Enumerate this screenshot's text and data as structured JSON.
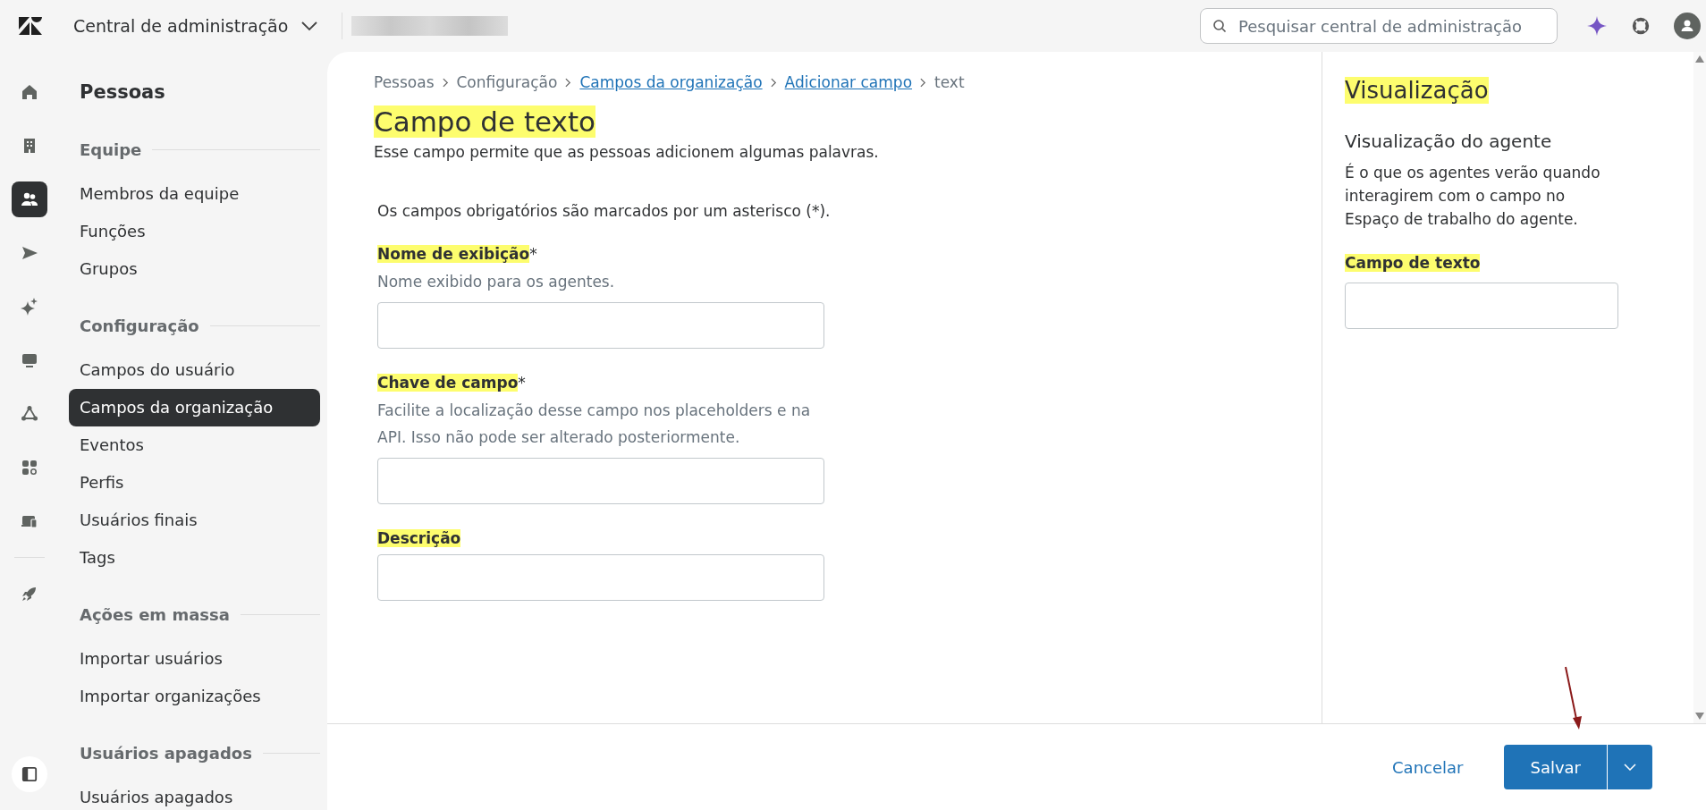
{
  "topbar": {
    "product": "Central de administração",
    "search": {
      "placeholder": "Pesquisar central de administração"
    }
  },
  "rail": [
    {
      "kind": "home",
      "selected": false
    },
    {
      "kind": "building",
      "selected": false
    },
    {
      "kind": "people",
      "selected": true
    },
    {
      "kind": "send",
      "selected": false
    },
    {
      "kind": "sparkle",
      "selected": false
    },
    {
      "kind": "monitor",
      "selected": false
    },
    {
      "kind": "network",
      "selected": false
    },
    {
      "kind": "apps",
      "selected": false
    },
    {
      "kind": "devices",
      "selected": false
    },
    {
      "kind": "rocket",
      "selected": false
    }
  ],
  "sidebar": {
    "title": "Pessoas",
    "sections": [
      {
        "heading": "Equipe",
        "items": [
          {
            "label": "Membros da equipe",
            "selected": false
          },
          {
            "label": "Funções",
            "selected": false
          },
          {
            "label": "Grupos",
            "selected": false
          }
        ]
      },
      {
        "heading": "Configuração",
        "items": [
          {
            "label": "Campos do usuário",
            "selected": false
          },
          {
            "label": "Campos da organização",
            "selected": true
          },
          {
            "label": "Eventos",
            "selected": false
          },
          {
            "label": "Perfis",
            "selected": false
          },
          {
            "label": "Usuários finais",
            "selected": false
          },
          {
            "label": "Tags",
            "selected": false
          }
        ]
      },
      {
        "heading": "Ações em massa",
        "items": [
          {
            "label": "Importar usuários",
            "selected": false
          },
          {
            "label": "Importar organizações",
            "selected": false
          }
        ]
      },
      {
        "heading": "Usuários apagados",
        "items": [
          {
            "label": "Usuários apagados",
            "selected": false
          }
        ]
      }
    ]
  },
  "breadcrumb": [
    {
      "label": "Pessoas",
      "link": false
    },
    {
      "label": "Configuração",
      "link": false
    },
    {
      "label": "Campos da organização",
      "link": true
    },
    {
      "label": "Adicionar campo",
      "link": true
    },
    {
      "label": "text",
      "link": false
    }
  ],
  "page": {
    "title": {
      "text": "Campo de texto",
      "highlighted": true
    },
    "description": "Esse campo permite que as pessoas adicionem algumas palavras.",
    "required_note": "Os campos obrigatórios são marcados por um asterisco (*)."
  },
  "fields": [
    {
      "label": "Nome de exibição",
      "highlighted": true,
      "required_mark": "*",
      "hint": "Nome exibido para os agentes."
    },
    {
      "label": "Chave de campo",
      "highlighted": true,
      "required_mark": "*",
      "hint": "Facilite a localização desse campo nos placeholders e na API. Isso não pode ser alterado posteriormente."
    },
    {
      "label": "Descrição",
      "highlighted": true
    }
  ],
  "preview": {
    "title": {
      "text": "Visualização",
      "highlighted": true
    },
    "subtitle": "Visualização do agente",
    "description": "É o que os agentes verão quando interagirem com o campo no Espaço de trabalho do agente.",
    "field_label": {
      "text": "Campo de texto",
      "highlighted": true
    }
  },
  "footer": {
    "cancel": "Cancelar",
    "save": "Salvar"
  }
}
